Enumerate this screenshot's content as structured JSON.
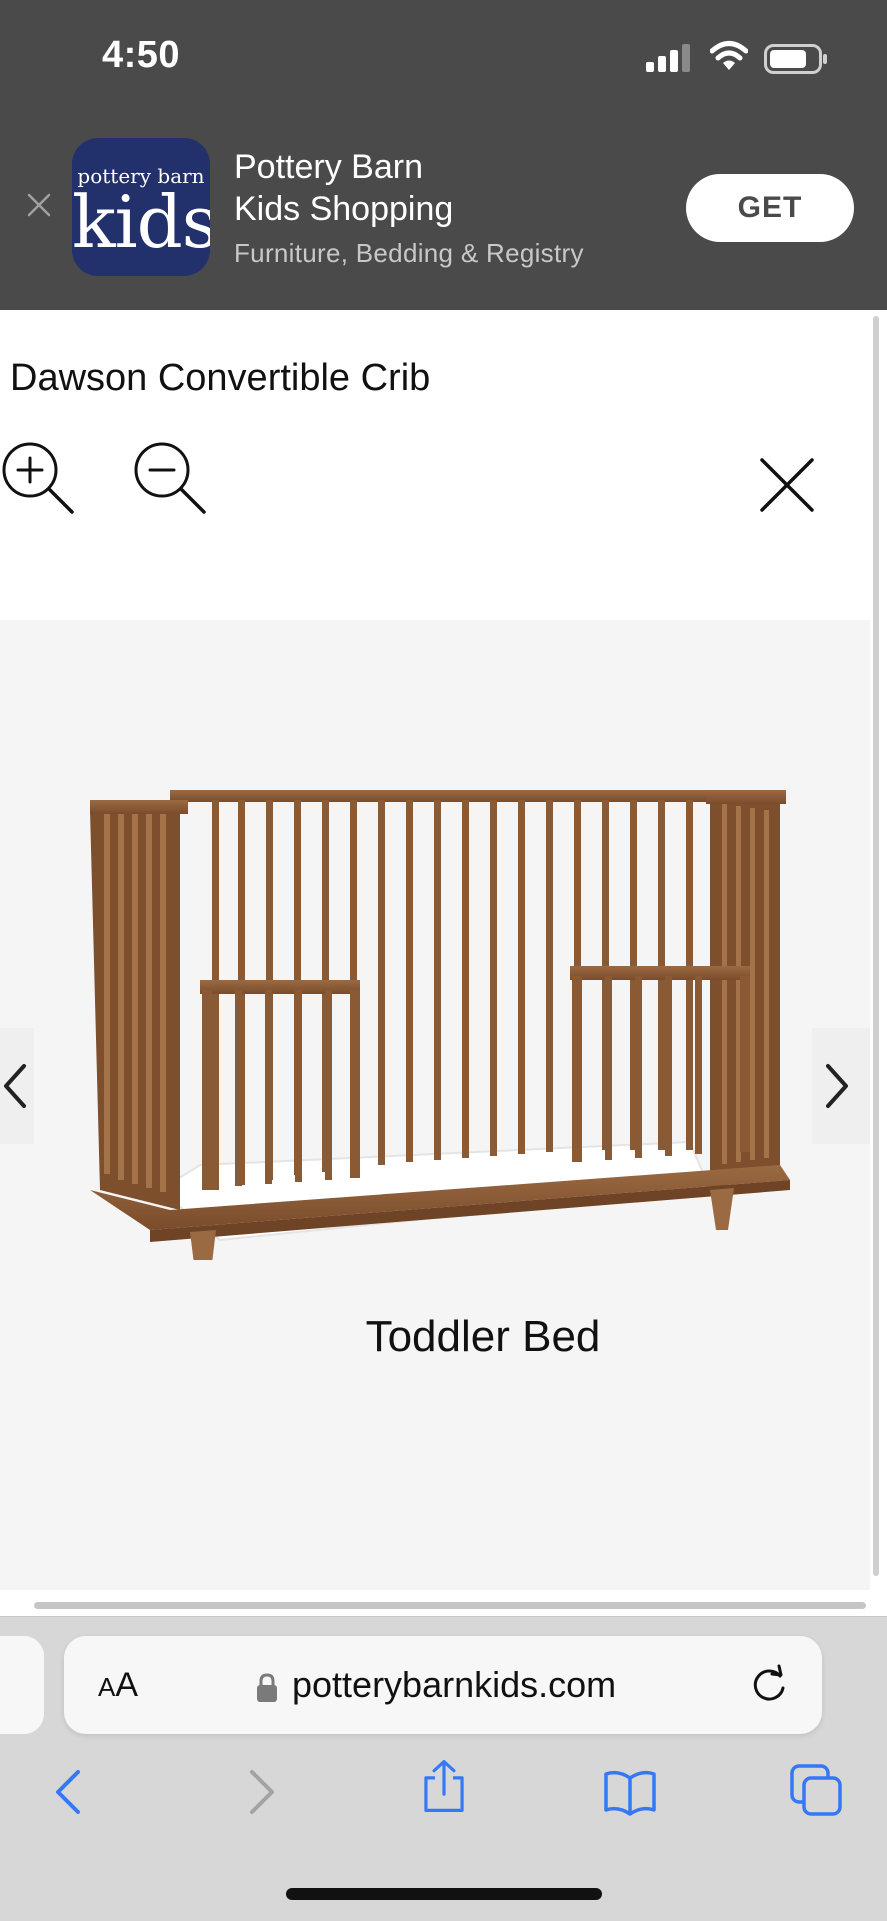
{
  "status_bar": {
    "time": "4:50"
  },
  "app_banner": {
    "icon_text_small": "pottery barn",
    "icon_text_big": "kids",
    "name_line1": "Pottery Barn",
    "name_line2": "Kids Shopping",
    "subtitle": "Furniture, Bedding & Registry",
    "get_label": "GET"
  },
  "product": {
    "title": "Dawson Convertible Crib",
    "image_caption": "Toddler Bed"
  },
  "browser": {
    "text_size_label_small": "A",
    "text_size_label_big": "A",
    "url": "potterybarnkids.com"
  },
  "colors": {
    "banner_bg": "#4a4a4a",
    "app_icon_bg": "#22306b",
    "viewer_bg": "#f5f5f5",
    "toolbar_bg": "#d7d7d7",
    "ios_blue": "#3478f6",
    "crib_wood": "#8a5a35"
  },
  "icons": {
    "close_banner": "close-icon",
    "zoom_in": "zoom-in-icon",
    "zoom_out": "zoom-out-icon",
    "close_viewer": "close-icon",
    "prev": "chevron-left-icon",
    "next": "chevron-right-icon",
    "lock": "lock-icon",
    "reload": "reload-icon",
    "back": "chevron-left-icon",
    "forward": "chevron-right-icon",
    "share": "share-icon",
    "bookmarks": "book-icon",
    "tabs": "tabs-icon"
  }
}
